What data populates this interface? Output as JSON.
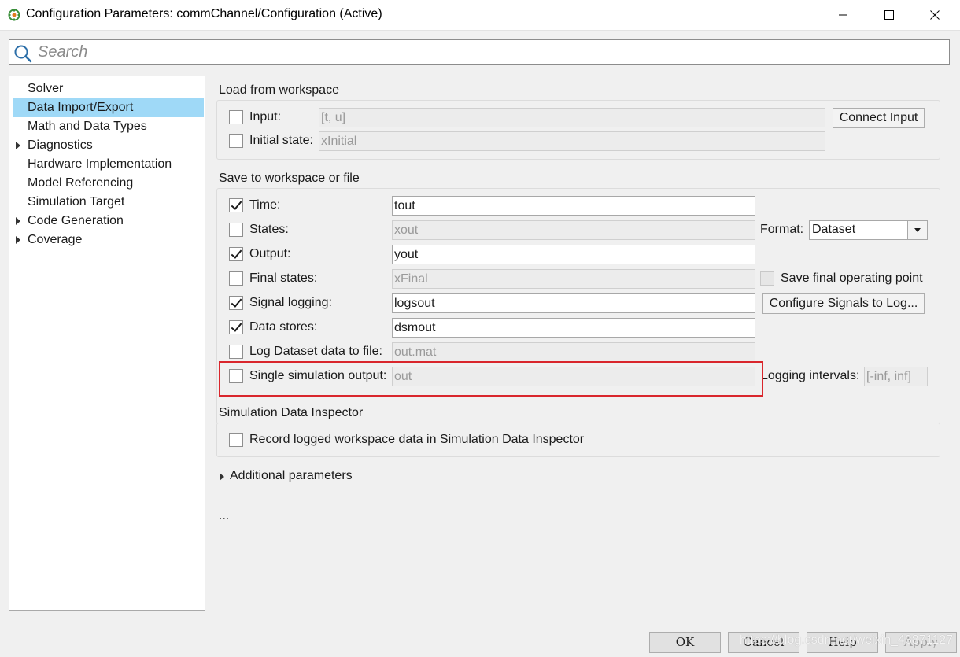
{
  "window": {
    "title": "Configuration Parameters: commChannel/Configuration (Active)",
    "icon": "simulink-config-icon",
    "controls": {
      "minimize": "minimize-icon",
      "maximize": "maximize-icon",
      "close": "close-icon"
    }
  },
  "search": {
    "placeholder": "Search",
    "value": ""
  },
  "sidebar": {
    "items": [
      {
        "label": "Solver",
        "expandable": false,
        "selected": false
      },
      {
        "label": "Data Import/Export",
        "expandable": false,
        "selected": true
      },
      {
        "label": "Math and Data Types",
        "expandable": false,
        "selected": false
      },
      {
        "label": "Diagnostics",
        "expandable": true,
        "selected": false
      },
      {
        "label": "Hardware Implementation",
        "expandable": false,
        "selected": false
      },
      {
        "label": "Model Referencing",
        "expandable": false,
        "selected": false
      },
      {
        "label": "Simulation Target",
        "expandable": false,
        "selected": false
      },
      {
        "label": "Code Generation",
        "expandable": true,
        "selected": false
      },
      {
        "label": "Coverage",
        "expandable": true,
        "selected": false
      }
    ]
  },
  "load_section": {
    "title": "Load from workspace",
    "input": {
      "label": "Input:",
      "value": "[t, u]",
      "checked": false
    },
    "initial_state": {
      "label": "Initial state:",
      "value": "xInitial",
      "checked": false
    },
    "connect_button": "Connect Input"
  },
  "save_section": {
    "title": "Save to workspace or file",
    "time": {
      "label": "Time:",
      "value": "tout",
      "checked": true
    },
    "states": {
      "label": "States:",
      "value": "xout",
      "checked": false
    },
    "output": {
      "label": "Output:",
      "value": "yout",
      "checked": true
    },
    "final_states": {
      "label": "Final states:",
      "value": "xFinal",
      "checked": false
    },
    "signal_logging": {
      "label": "Signal logging:",
      "value": "logsout",
      "checked": true
    },
    "data_stores": {
      "label": "Data stores:",
      "value": "dsmout",
      "checked": true
    },
    "log_dataset": {
      "label": "Log Dataset data to file:",
      "value": "out.mat",
      "checked": false
    },
    "single_sim_output": {
      "label": "Single simulation output:",
      "value": "out",
      "checked": false
    },
    "format_label": "Format:",
    "format_value": "Dataset",
    "save_final_op": {
      "label": "Save final operating point",
      "checked": false
    },
    "configure_signals_button": "Configure Signals to Log...",
    "logging_intervals_label": "Logging intervals:",
    "logging_intervals_value": "[-inf, inf]",
    "highlight_color": "#d9262c"
  },
  "sdi_section": {
    "title": "Simulation Data Inspector",
    "record": {
      "label": "Record logged workspace data in Simulation Data Inspector",
      "checked": false
    }
  },
  "additional_parameters": "Additional parameters",
  "ellipsis": "...",
  "buttons": {
    "ok": "OK",
    "cancel": "Cancel",
    "help": "Help",
    "apply": "Apply"
  },
  "watermark": "https://blog.csdn.net/weixin_43871127"
}
